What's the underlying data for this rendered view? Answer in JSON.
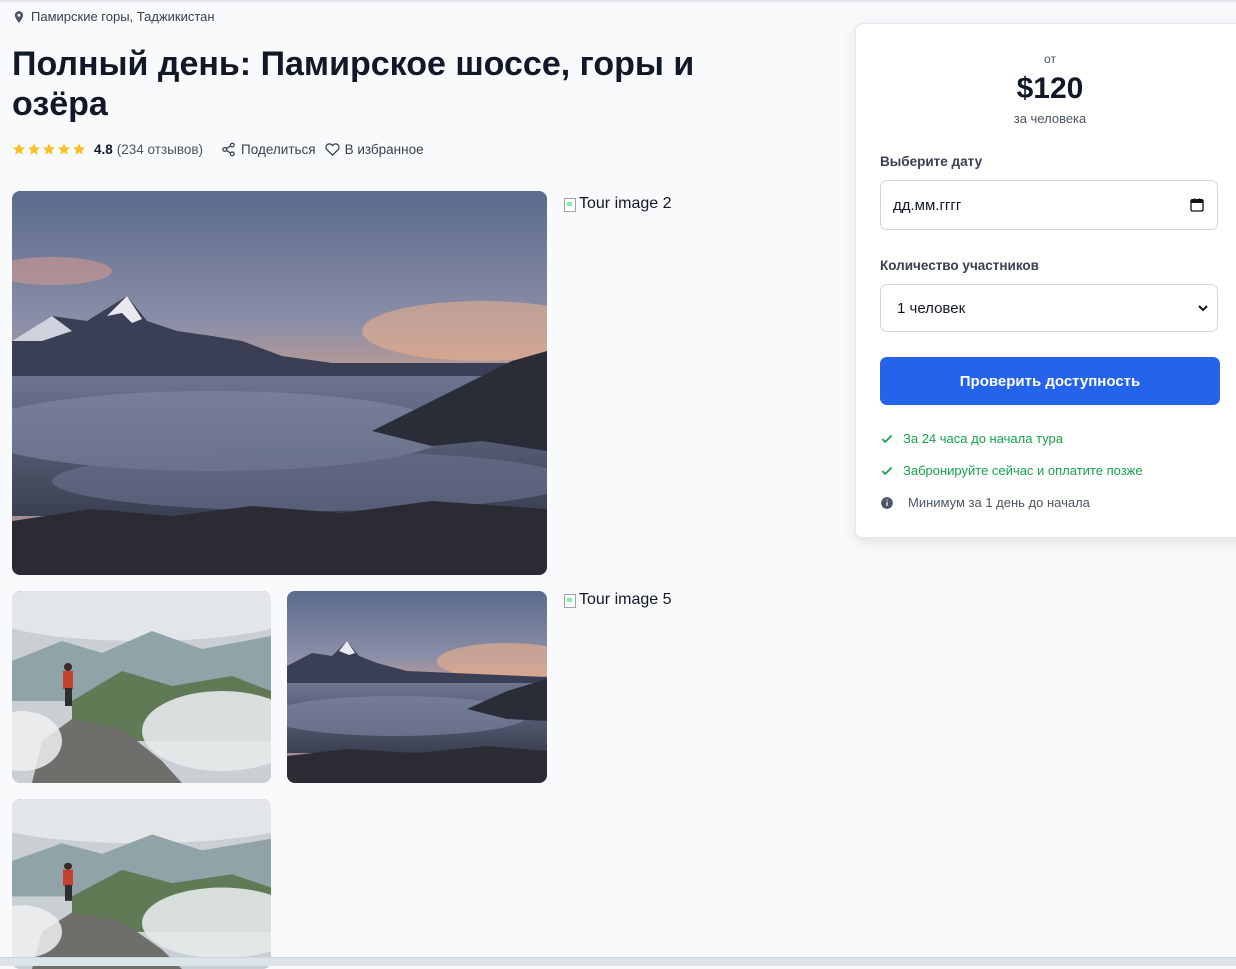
{
  "location": {
    "text": "Памирские горы, Таджикистан",
    "icon": "map-pin-icon"
  },
  "title": "Полный день: Памирское шоссе, горы и озёра",
  "rating": {
    "stars": 5,
    "value": "4.8",
    "reviews": "(234 отзывов)"
  },
  "actions": {
    "share": "Поделиться",
    "favorite": "В избранное"
  },
  "gallery": {
    "broken_image_2": "Tour image 2",
    "broken_image_5": "Tour image 5"
  },
  "booking": {
    "price_from": "от",
    "price": "$120",
    "price_per": "за человека",
    "date_label": "Выберите дату",
    "date_placeholder": "дд.мм.гггг",
    "participants_label": "Количество участников",
    "participants_value": "1 человек",
    "cta": "Проверить доступность",
    "notes": [
      "За 24 часа до начала тура",
      "Забронируйте сейчас и оплатите позже",
      "Минимум за 1 день до начала"
    ]
  },
  "colors": {
    "accent": "#2563eb",
    "success": "#16a34a",
    "star": "#fbbf24"
  }
}
